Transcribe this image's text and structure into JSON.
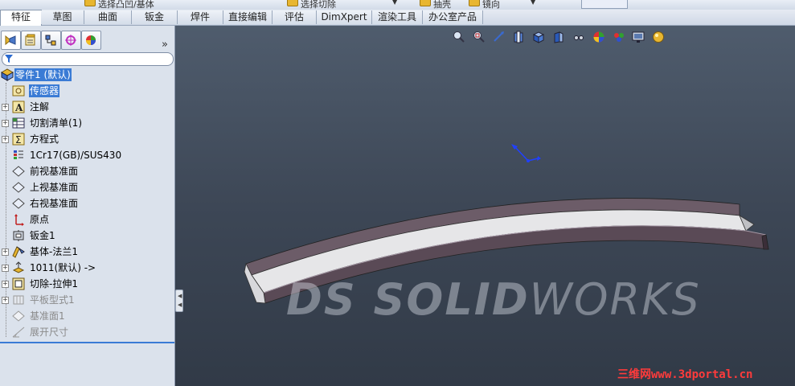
{
  "toolbar_strip": {
    "items": [
      {
        "label": "选择凸凹/基体"
      },
      {
        "label": "选择切除"
      },
      {
        "label": "抽壳"
      },
      {
        "label": "镜向"
      }
    ]
  },
  "command_tabs": [
    {
      "label": "特征",
      "active": true
    },
    {
      "label": "草图"
    },
    {
      "label": "曲面"
    },
    {
      "label": "钣金"
    },
    {
      "label": "焊件"
    },
    {
      "label": "直接编辑"
    },
    {
      "label": "评估"
    },
    {
      "label": "DimXpert"
    },
    {
      "label": "渲染工具"
    },
    {
      "label": "办公室产品"
    }
  ],
  "panel": {
    "expand_symbol": "»",
    "tree": [
      {
        "label": "零件1 (默认)",
        "icon": "part-icon",
        "root": true,
        "selected": true
      },
      {
        "label": "传感器",
        "icon": "sensor-icon",
        "selected": true
      },
      {
        "label": "注解",
        "icon": "annotation-icon",
        "expandable": true
      },
      {
        "label": "切割清单(1)",
        "icon": "cut-list-icon",
        "expandable": true
      },
      {
        "label": "方程式",
        "icon": "equation-icon",
        "expandable": true
      },
      {
        "label": "1Cr17(GB)/SUS430",
        "icon": "material-icon"
      },
      {
        "label": "前视基准面",
        "icon": "plane-icon"
      },
      {
        "label": "上视基准面",
        "icon": "plane-icon"
      },
      {
        "label": "右视基准面",
        "icon": "plane-icon"
      },
      {
        "label": "原点",
        "icon": "origin-icon"
      },
      {
        "label": "钣金1",
        "icon": "sheet-metal-icon"
      },
      {
        "label": "基体-法兰1",
        "icon": "base-flange-icon",
        "expandable": true
      },
      {
        "label": "1011(默认) ->",
        "icon": "derived-part-icon",
        "expandable": true
      },
      {
        "label": "切除-拉伸1",
        "icon": "cut-extrude-icon",
        "expandable": true
      },
      {
        "label": "平板型式1",
        "icon": "flat-pattern-icon",
        "expandable": true,
        "dim": true
      },
      {
        "label": "基准面1",
        "icon": "plane-icon",
        "dim": true
      },
      {
        "label": "展开尺寸",
        "icon": "unfold-icon",
        "dim": true
      }
    ]
  },
  "viewport": {
    "watermark": {
      "ds": "DS",
      "solid": "SOLID",
      "works": "WORKS"
    },
    "footer": "三维网www.3dportal.cn"
  },
  "colors": {
    "accent": "#3a7bd5",
    "footer": "#ff3b3b",
    "viewport_top": "#4f5c6d",
    "viewport_bottom": "#313a47"
  }
}
